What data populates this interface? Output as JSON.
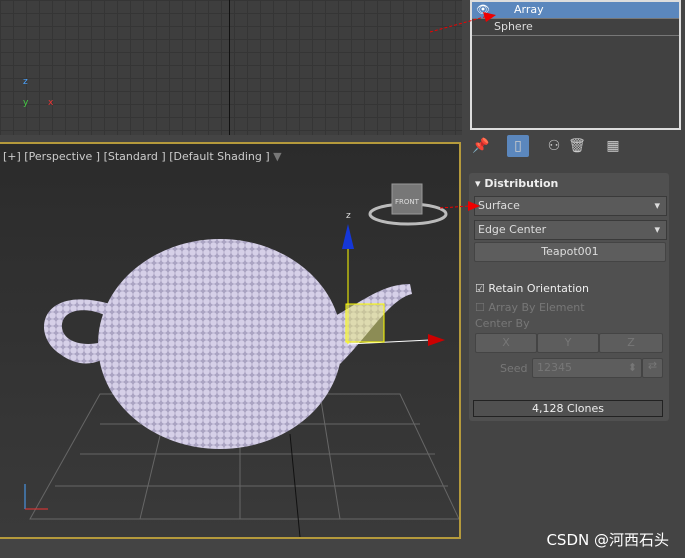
{
  "viewport": {
    "label": "[+] [Perspective ] [Standard ] [Default Shading ]",
    "gizmo_label": "FRONT",
    "axes": {
      "x": "x",
      "y": "y",
      "z": "z"
    }
  },
  "scene_list": {
    "items": [
      {
        "label": "Array",
        "selected": true
      },
      {
        "label": "Sphere",
        "selected": false
      }
    ]
  },
  "toolbar": {
    "icons": [
      "pin-icon",
      "modifier-stack-icon",
      "make-unique-icon",
      "trash-icon",
      "configure-icon"
    ]
  },
  "rollout": {
    "title": "Distribution",
    "distribution_mode": "Surface",
    "mode2": "Edge Center",
    "target_button": "Teapot001",
    "retain_orientation": {
      "label": "Retain Orientation",
      "checked": true
    },
    "array_by_element": {
      "label": "Array By Element",
      "checked": false
    },
    "center_by": {
      "label": "Center By",
      "buttons": [
        "X",
        "Y",
        "Z"
      ]
    },
    "seed": {
      "label": "Seed",
      "value": "12345"
    },
    "clones": "4,128 Clones"
  },
  "colors": {
    "selection": "#5b87bd",
    "viewport_border": "#b59a3c",
    "teapot": "#c9c3dc"
  },
  "watermark": "CSDN @河西石头"
}
